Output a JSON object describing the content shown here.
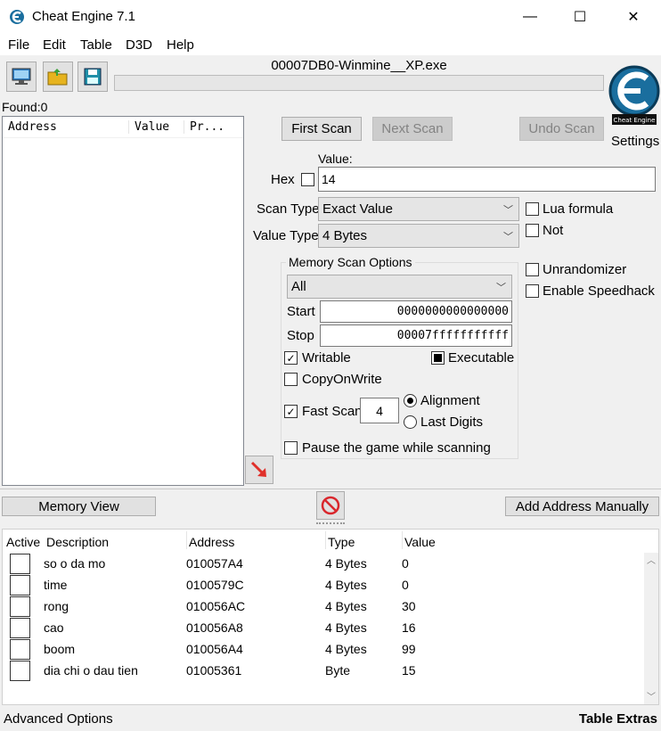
{
  "window": {
    "title": "Cheat Engine 7.1",
    "minimize": "—",
    "maximize": "☐",
    "close": "✕"
  },
  "menu": [
    "File",
    "Edit",
    "Table",
    "D3D",
    "Help"
  ],
  "process_name": "00007DB0-Winmine__XP.exe",
  "found_label": "Found:0",
  "results_headers": {
    "address": "Address",
    "value": "Value",
    "previous": "Pr..."
  },
  "scan_buttons": {
    "first": "First Scan",
    "next": "Next Scan",
    "undo": "Undo Scan"
  },
  "settings_label": "Settings",
  "logo_text": "Cheat Engine",
  "value_section": {
    "label": "Value:",
    "hex_label": "Hex",
    "value": "14"
  },
  "scan_type": {
    "label": "Scan Type",
    "selected": "Exact Value"
  },
  "value_type": {
    "label": "Value Type",
    "selected": "4 Bytes"
  },
  "options_right": {
    "lua_formula": "Lua formula",
    "not": "Not",
    "unrandomizer": "Unrandomizer",
    "speedhack": "Enable Speedhack"
  },
  "memory_scan_options": {
    "title": "Memory Scan Options",
    "region": "All",
    "start_label": "Start",
    "start_value": "0000000000000000",
    "stop_label": "Stop",
    "stop_value": "00007fffffffffff",
    "writable": "Writable",
    "executable": "Executable",
    "copy_on_write": "CopyOnWrite",
    "fast_scan": "Fast Scan",
    "fast_scan_value": "4",
    "alignment": "Alignment",
    "last_digits": "Last Digits",
    "pause_game": "Pause the game while scanning"
  },
  "memory_view_button": "Memory View",
  "add_address_button": "Add Address Manually",
  "table_headers": {
    "active": "Active",
    "description": "Description",
    "address": "Address",
    "type": "Type",
    "value": "Value"
  },
  "table_rows": [
    {
      "description": "so o da mo",
      "address": "010057A4",
      "type": "4 Bytes",
      "value": "0"
    },
    {
      "description": "time",
      "address": "0100579C",
      "type": "4 Bytes",
      "value": "0"
    },
    {
      "description": "rong",
      "address": "010056AC",
      "type": "4 Bytes",
      "value": "30"
    },
    {
      "description": "cao",
      "address": "010056A8",
      "type": "4 Bytes",
      "value": "16"
    },
    {
      "description": "boom",
      "address": "010056A4",
      "type": "4 Bytes",
      "value": "99"
    },
    {
      "description": "dia chi o dau tien",
      "address": "01005361",
      "type": "Byte",
      "value": "15"
    }
  ],
  "footer": {
    "advanced_options": "Advanced Options",
    "table_extras": "Table Extras"
  },
  "colors": {
    "accent": "#0a6fa8",
    "arrow": "#e0302a",
    "stop_icon": "#d9262c"
  }
}
